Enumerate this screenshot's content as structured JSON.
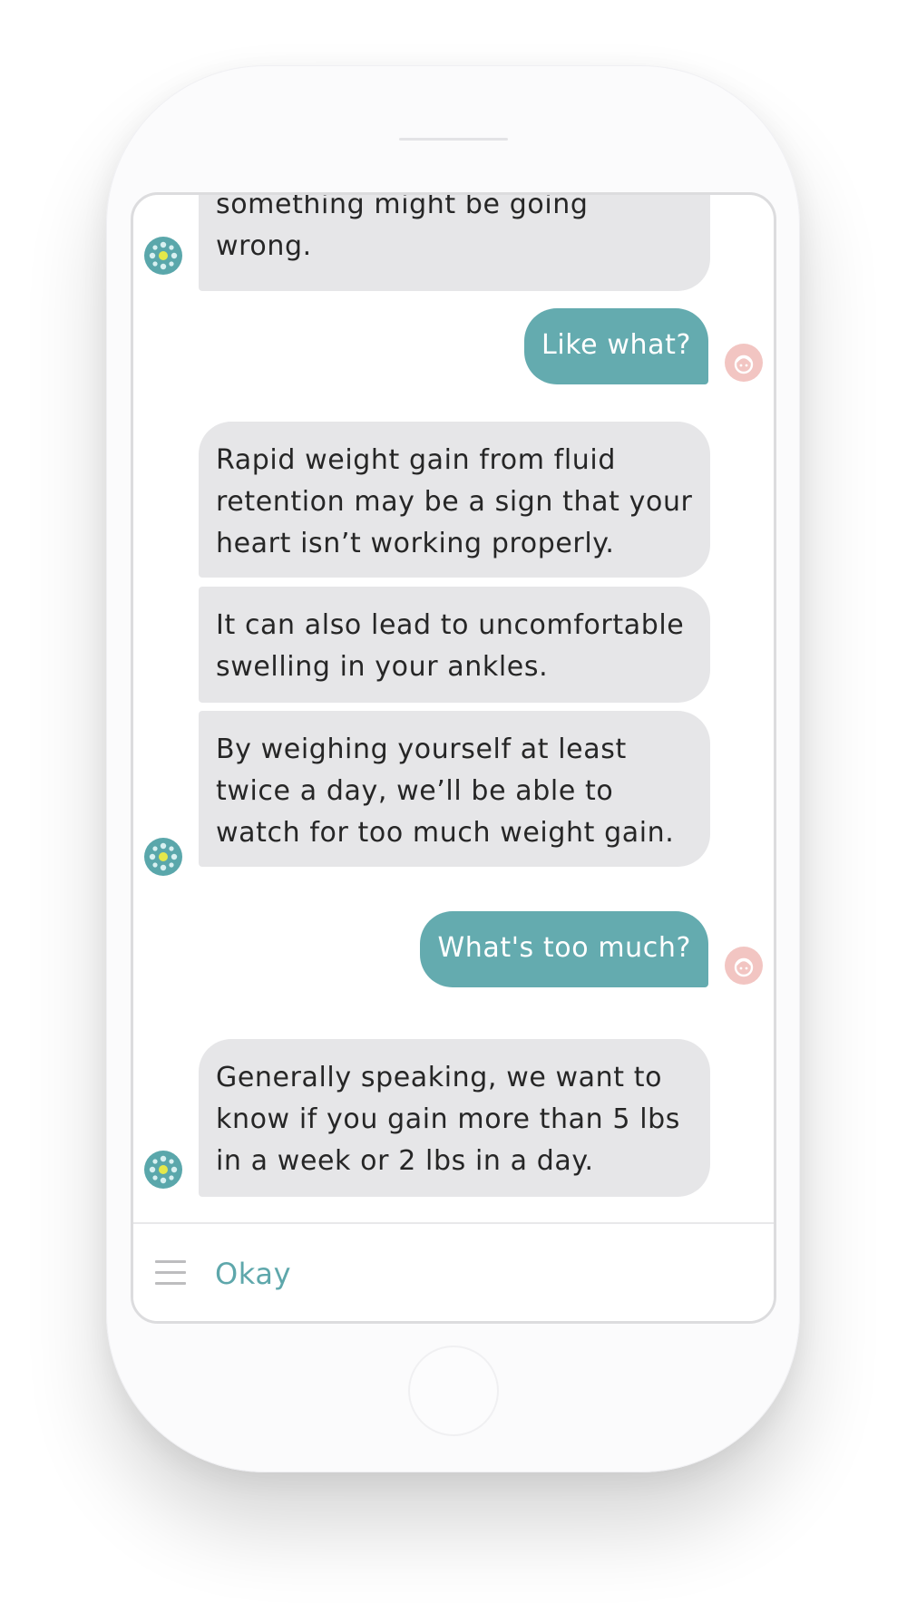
{
  "colors": {
    "bot_bubble": "#e6e6e8",
    "user_bubble": "#64abaf",
    "accent": "#5ea7ab",
    "user_avatar": "#f2c5c2",
    "bot_avatar": "#5aa7ab"
  },
  "chat": {
    "messages": [
      {
        "sender": "bot",
        "text": "something might be going\nwrong."
      },
      {
        "sender": "user",
        "text": "Like what?"
      },
      {
        "sender": "bot",
        "text": "Rapid weight gain from fluid\nretention may be a sign that your\nheart isn’t working properly."
      },
      {
        "sender": "bot",
        "text": "It can also lead to uncomfortable\nswelling in your ankles."
      },
      {
        "sender": "bot",
        "text": "By weighing yourself at least\ntwice a day, we’ll be able to\nwatch for too much weight gain."
      },
      {
        "sender": "user",
        "text": "What's too much?"
      },
      {
        "sender": "bot",
        "text": "Generally speaking, we want to\nknow if you gain more than 5 lbs\nin a week or 2 lbs in a day."
      }
    ]
  },
  "composer": {
    "menu_icon": "hamburger-menu-icon",
    "quick_reply_label": "Okay"
  },
  "icons": {
    "bot_avatar": "bot-avatar-icon",
    "user_avatar": "user-avatar-icon"
  }
}
